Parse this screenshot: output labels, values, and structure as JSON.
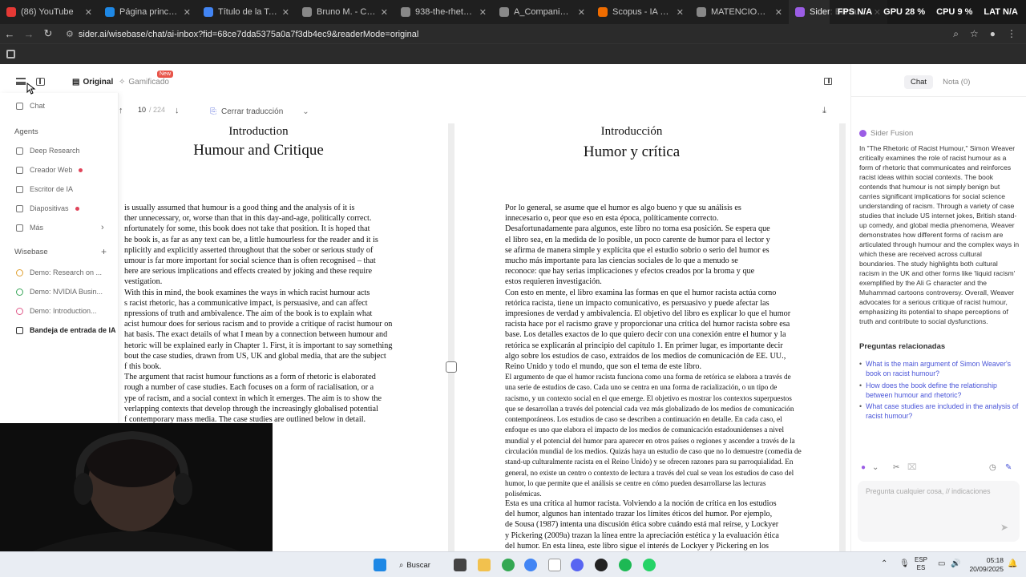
{
  "browser": {
    "tabs": [
      {
        "label": "(86) YouTube",
        "color": "#e53935"
      },
      {
        "label": "Página principal - Go",
        "color": "#1e88e5"
      },
      {
        "label": "Título de la Tesis - Do",
        "color": "#4285f4"
      },
      {
        "label": "Bruno M. - Caracterís",
        "color": "#888888"
      },
      {
        "label": "938-the-rhetoric-of-",
        "color": "#888888"
      },
      {
        "label": "A_Companion_to_film",
        "color": "#888888"
      },
      {
        "label": "Scopus - IA de Scopu",
        "color": "#ef6c00"
      },
      {
        "label": "MATENCIO_NUÑEZ_",
        "color": "#888888"
      },
      {
        "label": "Sider: Barra lateral c",
        "color": "#9b5de5"
      }
    ],
    "sysmon": {
      "fps": "FPS",
      "fps_val": "N/A",
      "gpu": "GPU",
      "gpu_val": "28 %",
      "cpu": "CPU",
      "cpu_val": "9 %",
      "lat": "LAT",
      "lat_val": "N/A"
    },
    "url": "sider.ai/wisebase/chat/ai-inbox?fid=68ce7dda5375a0a7f3db4ec9&readerMode=original"
  },
  "toolbar": {
    "original": "Original",
    "gamified": "Gamificado",
    "new_badge": "New"
  },
  "pager": {
    "current": "10",
    "total": "/ 224",
    "translate_label": "Cerrar traducción"
  },
  "sidemenu": {
    "chat": "Chat",
    "agents_head": "Agents",
    "deep_research": "Deep Research",
    "web_creator": "Creador Web",
    "ai_writer": "Escritor de IA",
    "slides": "Diapositivas",
    "more": "Más",
    "wisebase_head": "Wisebase",
    "demo1": "Demo: Research on ...",
    "demo2": "Demo: NVIDIA Busin...",
    "demo3": "Demo: Introduction...",
    "inbox": "Bandeja de entrada de IA"
  },
  "doc_en": {
    "heading": "Introduction",
    "title": "Humour and Critique",
    "lines": [
      "is usually assumed that humour is a good thing and the analysis of it is",
      "ther unnecessary, or, worse than that in this day-and-age, politically correct.",
      "nfortunately for some, this book does not take that position. It is hoped that",
      "he book is, as far as any text can be, a little humourless for the reader and it is",
      "nplicitly and explicitly asserted throughout that the sober or serious study of",
      "umour is far more important for social science than is often recognised – that",
      "here are serious implications and effects created by joking and these require",
      "vestigation.",
      "With this in mind, the book examines the ways in which racist humour acts",
      "s racist rhetoric, has a communicative impact, is persuasive, and can affect",
      "npressions of truth and ambivalence. The aim of the book is to explain what",
      "acist humour does for serious racism and to provide a critique of racist humour on",
      "hat basis. The exact details of what I mean by a connection between humour and",
      "hetoric will be explained early in Chapter 1. First, it is important to say something",
      "bout the case studies, drawn from US, UK and global media, that are the subject",
      "f this book.",
      "The argument that racist humour functions as a form of rhetoric is elaborated",
      "rough a number of case studies. Each focuses on a form of racialisation, or a",
      "ype of racism, and a social context in which it emerges. The aim is to show the",
      "verlapping contexts that develop through the increasingly globalised potential",
      "f contemporary mass media. The case studies are outlined below in detail.",
      "es the impact of US media globally",
      "ther countries or regions and ascend",
      "erhaps one case study that does not",
      "comedy in the UK – and reasons for",
      "no one centre or context of reading",
      "re viewed, which allows the analysis",
      "elop.",
      "to the notion of critique in humour",
      "ical limits of humour. For example,",
      "on of when it is wrong to laugh, and",
      "e between the aesthetic appreciation",
      "ese lines, this book follows Lockyer"
    ]
  },
  "doc_es": {
    "heading": "Introducción",
    "title": "Humor y crítica",
    "lines_a": [
      "Por lo general, se asume que el humor es algo bueno y que su análisis es",
      "innecesario o, peor que eso en esta época, políticamente correcto.",
      "Desafortunadamente para algunos, este libro no toma esa posición. Se espera que",
      "el libro sea, en la medida de lo posible, un poco carente de humor para el lector y",
      "se afirma de manera simple y explícita que el estudio sobrio o serio del humor es",
      "mucho más importante para las ciencias sociales de lo que a menudo se",
      "reconoce: que hay serias implicaciones y efectos creados por la broma y que",
      "estos requieren investigación.",
      "Con esto en mente, el libro examina las formas en que el humor racista actúa como",
      "retórica racista, tiene un impacto comunicativo, es persuasivo y puede afectar las",
      "impresiones de verdad y ambivalencia. El objetivo del libro es explicar lo que el humor",
      "racista hace por el racismo grave y proporcionar una crítica del humor racista sobre esa",
      "base. Los detalles exactos de lo que quiero decir con una conexión entre el humor y la",
      "retórica se explicarán al principio del capítulo 1. En primer lugar, es importante decir",
      "algo sobre los estudios de caso, extraídos de los medios de comunicación de EE. UU.,",
      "Reino Unido y todo el mundo, que son el tema de este libro."
    ],
    "lines_b": [
      "El argumento de que el humor racista funciona como una forma de retórica se elabora a través de",
      "una serie de estudios de caso. Cada uno se centra en una forma de racialización, o un tipo de",
      "racismo, y un contexto social en el que emerge. El objetivo es mostrar los contextos superpuestos",
      "que se desarrollan a través del potencial cada vez más globalizado de los medios de comunicación",
      "contemporáneos. Los estudios de caso se describen a continuación en detalle. En cada caso, el",
      "enfoque es uno que elabora el impacto de los medios de comunicación estadounidenses a nivel",
      "mundial y el potencial del humor para aparecer en otros países o regiones y ascender a través de la",
      "circulación mundial de los medios. Quizás haya un estudio de caso que no lo demuestre (comedia de",
      "stand-up culturalmente racista en el Reino Unido) y se ofrecen razones para su parroquialidad. En",
      "general, no existe un centro o contexto de lectura a través del cual se vean los estudios de caso del",
      "humor, lo que permite que el análisis se centre en cómo pueden desarrollarse las lecturas",
      "polisémicas."
    ],
    "lines_c": [
      "Esta es una crítica al humor racista. Volviendo a la noción de crítica en los estudios",
      "del humor, algunos han intentado trazar los límites éticos del humor. Por ejemplo,",
      "de Sousa (1987) intenta una discusión ética sobre cuándo está mal reírse, y Lockyer",
      "y Pickering (2009a) trazan la línea entre la apreciación estética y la evaluación ética",
      "del humor. En esta línea, este libro sigue el interés de Lockyer y Pickering en los"
    ]
  },
  "rightpanel": {
    "tab_chat": "Chat",
    "tab_note": "Nota (0)",
    "model": "Sider Fusion",
    "answer": "In \"The Rhetoric of Racist Humour,\" Simon Weaver critically examines the role of racist humour as a form of rhetoric that communicates and reinforces racist ideas within social contexts. The book contends that humour is not simply benign but carries significant implications for social science understanding of racism. Through a variety of case studies that include US internet jokes, British stand-up comedy, and global media phenomena, Weaver demonstrates how different forms of racism are articulated through humour and the complex ways in which these are received across cultural boundaries. The study highlights both cultural racism in the UK and other forms like 'liquid racism' exemplified by the Ali G character and the Muhammad cartoons controversy. Overall, Weaver advocates for a serious critique of racist humour, emphasizing its potential to shape perceptions of truth and contribute to social dysfunctions.",
    "related_head": "Preguntas relacionadas",
    "related": [
      "What is the main argument of Simon Weaver's book on racist humour?",
      "How does the book define the relationship between humour and rhetoric?",
      "What case studies are included in the analysis of racist humour?"
    ],
    "input_placeholder": "Pregunta cualquier cosa, // indicaciones"
  },
  "taskbar": {
    "search": "Buscar",
    "lang_1": "ESP",
    "lang_2": "ES",
    "time": "05:18",
    "date": "20/09/2025"
  },
  "colors": {
    "accent": "#4a55d8",
    "sider": "#9b5de5",
    "badge": "#e8554a"
  }
}
